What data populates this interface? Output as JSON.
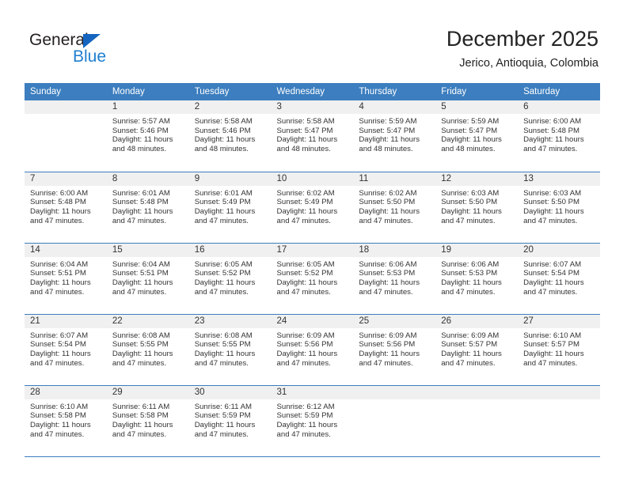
{
  "brand": {
    "name_top": "General",
    "name_bottom": "Blue",
    "triangle_color": "#1565c0",
    "blue_color": "#1f7fd0"
  },
  "header": {
    "title": "December 2025",
    "subtitle": "Jerico, Antioquia, Colombia"
  },
  "theme": {
    "header_blue": "#3c7ebf",
    "daynum_band": "#f0f0f0",
    "text": "#333333"
  },
  "weekdays": [
    "Sunday",
    "Monday",
    "Tuesday",
    "Wednesday",
    "Thursday",
    "Friday",
    "Saturday"
  ],
  "labels": {
    "sunrise_prefix": "Sunrise:",
    "sunset_prefix": "Sunset:",
    "daylight_prefix": "Daylight:"
  },
  "weeks": [
    [
      {
        "day": "",
        "blank": true
      },
      {
        "day": "1",
        "sunrise": "Sunrise: 5:57 AM",
        "sunset": "Sunset: 5:46 PM",
        "daylight": "Daylight: 11 hours and 48 minutes."
      },
      {
        "day": "2",
        "sunrise": "Sunrise: 5:58 AM",
        "sunset": "Sunset: 5:46 PM",
        "daylight": "Daylight: 11 hours and 48 minutes."
      },
      {
        "day": "3",
        "sunrise": "Sunrise: 5:58 AM",
        "sunset": "Sunset: 5:47 PM",
        "daylight": "Daylight: 11 hours and 48 minutes."
      },
      {
        "day": "4",
        "sunrise": "Sunrise: 5:59 AM",
        "sunset": "Sunset: 5:47 PM",
        "daylight": "Daylight: 11 hours and 48 minutes."
      },
      {
        "day": "5",
        "sunrise": "Sunrise: 5:59 AM",
        "sunset": "Sunset: 5:47 PM",
        "daylight": "Daylight: 11 hours and 48 minutes."
      },
      {
        "day": "6",
        "sunrise": "Sunrise: 6:00 AM",
        "sunset": "Sunset: 5:48 PM",
        "daylight": "Daylight: 11 hours and 47 minutes."
      }
    ],
    [
      {
        "day": "7",
        "sunrise": "Sunrise: 6:00 AM",
        "sunset": "Sunset: 5:48 PM",
        "daylight": "Daylight: 11 hours and 47 minutes."
      },
      {
        "day": "8",
        "sunrise": "Sunrise: 6:01 AM",
        "sunset": "Sunset: 5:48 PM",
        "daylight": "Daylight: 11 hours and 47 minutes."
      },
      {
        "day": "9",
        "sunrise": "Sunrise: 6:01 AM",
        "sunset": "Sunset: 5:49 PM",
        "daylight": "Daylight: 11 hours and 47 minutes."
      },
      {
        "day": "10",
        "sunrise": "Sunrise: 6:02 AM",
        "sunset": "Sunset: 5:49 PM",
        "daylight": "Daylight: 11 hours and 47 minutes."
      },
      {
        "day": "11",
        "sunrise": "Sunrise: 6:02 AM",
        "sunset": "Sunset: 5:50 PM",
        "daylight": "Daylight: 11 hours and 47 minutes."
      },
      {
        "day": "12",
        "sunrise": "Sunrise: 6:03 AM",
        "sunset": "Sunset: 5:50 PM",
        "daylight": "Daylight: 11 hours and 47 minutes."
      },
      {
        "day": "13",
        "sunrise": "Sunrise: 6:03 AM",
        "sunset": "Sunset: 5:50 PM",
        "daylight": "Daylight: 11 hours and 47 minutes."
      }
    ],
    [
      {
        "day": "14",
        "sunrise": "Sunrise: 6:04 AM",
        "sunset": "Sunset: 5:51 PM",
        "daylight": "Daylight: 11 hours and 47 minutes."
      },
      {
        "day": "15",
        "sunrise": "Sunrise: 6:04 AM",
        "sunset": "Sunset: 5:51 PM",
        "daylight": "Daylight: 11 hours and 47 minutes."
      },
      {
        "day": "16",
        "sunrise": "Sunrise: 6:05 AM",
        "sunset": "Sunset: 5:52 PM",
        "daylight": "Daylight: 11 hours and 47 minutes."
      },
      {
        "day": "17",
        "sunrise": "Sunrise: 6:05 AM",
        "sunset": "Sunset: 5:52 PM",
        "daylight": "Daylight: 11 hours and 47 minutes."
      },
      {
        "day": "18",
        "sunrise": "Sunrise: 6:06 AM",
        "sunset": "Sunset: 5:53 PM",
        "daylight": "Daylight: 11 hours and 47 minutes."
      },
      {
        "day": "19",
        "sunrise": "Sunrise: 6:06 AM",
        "sunset": "Sunset: 5:53 PM",
        "daylight": "Daylight: 11 hours and 47 minutes."
      },
      {
        "day": "20",
        "sunrise": "Sunrise: 6:07 AM",
        "sunset": "Sunset: 5:54 PM",
        "daylight": "Daylight: 11 hours and 47 minutes."
      }
    ],
    [
      {
        "day": "21",
        "sunrise": "Sunrise: 6:07 AM",
        "sunset": "Sunset: 5:54 PM",
        "daylight": "Daylight: 11 hours and 47 minutes."
      },
      {
        "day": "22",
        "sunrise": "Sunrise: 6:08 AM",
        "sunset": "Sunset: 5:55 PM",
        "daylight": "Daylight: 11 hours and 47 minutes."
      },
      {
        "day": "23",
        "sunrise": "Sunrise: 6:08 AM",
        "sunset": "Sunset: 5:55 PM",
        "daylight": "Daylight: 11 hours and 47 minutes."
      },
      {
        "day": "24",
        "sunrise": "Sunrise: 6:09 AM",
        "sunset": "Sunset: 5:56 PM",
        "daylight": "Daylight: 11 hours and 47 minutes."
      },
      {
        "day": "25",
        "sunrise": "Sunrise: 6:09 AM",
        "sunset": "Sunset: 5:56 PM",
        "daylight": "Daylight: 11 hours and 47 minutes."
      },
      {
        "day": "26",
        "sunrise": "Sunrise: 6:09 AM",
        "sunset": "Sunset: 5:57 PM",
        "daylight": "Daylight: 11 hours and 47 minutes."
      },
      {
        "day": "27",
        "sunrise": "Sunrise: 6:10 AM",
        "sunset": "Sunset: 5:57 PM",
        "daylight": "Daylight: 11 hours and 47 minutes."
      }
    ],
    [
      {
        "day": "28",
        "sunrise": "Sunrise: 6:10 AM",
        "sunset": "Sunset: 5:58 PM",
        "daylight": "Daylight: 11 hours and 47 minutes."
      },
      {
        "day": "29",
        "sunrise": "Sunrise: 6:11 AM",
        "sunset": "Sunset: 5:58 PM",
        "daylight": "Daylight: 11 hours and 47 minutes."
      },
      {
        "day": "30",
        "sunrise": "Sunrise: 6:11 AM",
        "sunset": "Sunset: 5:59 PM",
        "daylight": "Daylight: 11 hours and 47 minutes."
      },
      {
        "day": "31",
        "sunrise": "Sunrise: 6:12 AM",
        "sunset": "Sunset: 5:59 PM",
        "daylight": "Daylight: 11 hours and 47 minutes."
      },
      {
        "day": "",
        "blank": true
      },
      {
        "day": "",
        "blank": true
      },
      {
        "day": "",
        "blank": true
      }
    ]
  ]
}
